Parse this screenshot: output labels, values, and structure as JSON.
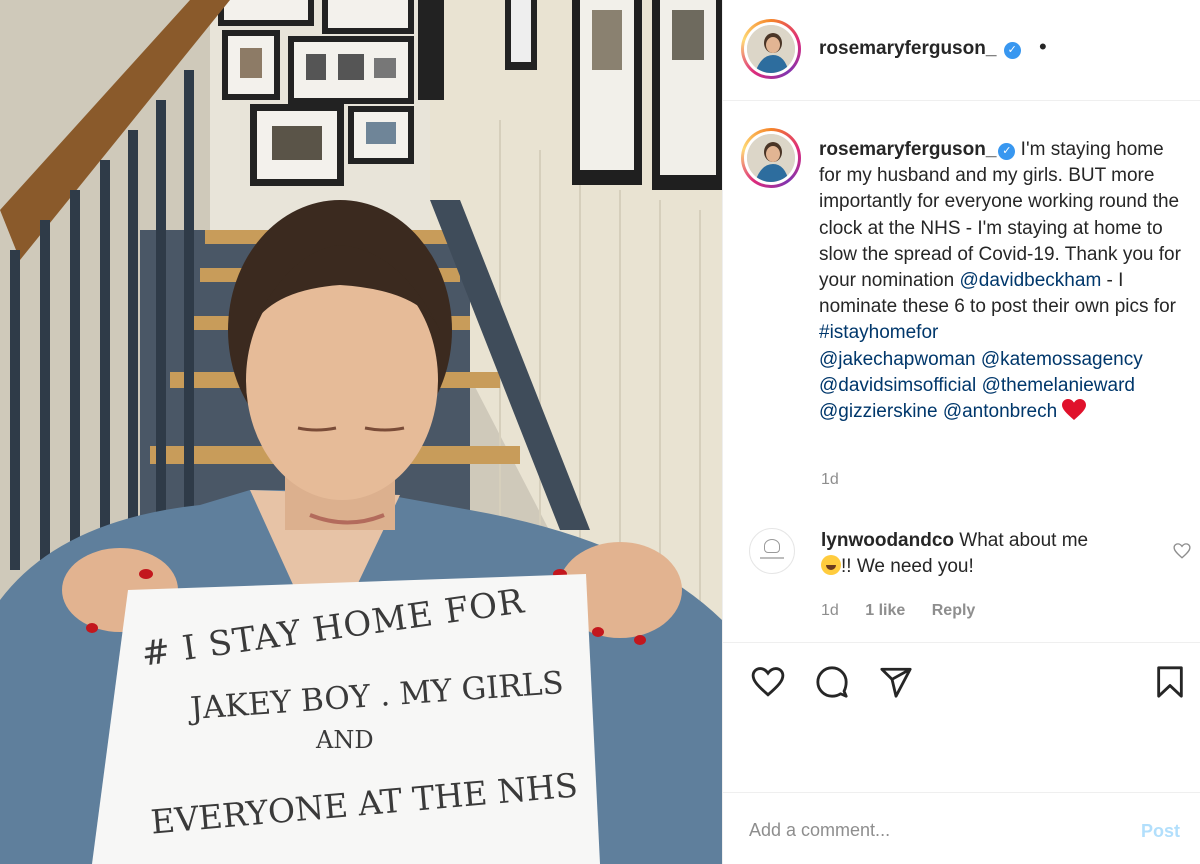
{
  "post": {
    "username": "rosemaryferguson_",
    "verified_mark": "✓",
    "more_dot": "•",
    "caption_parts": {
      "p1": " I'm staying home for my husband and my girls. BUT more importantly for everyone working round the clock at the NHS - I'm staying at home to slow the spread of Covid-19. Thank you for your nomination ",
      "m1": "@davidbeckham",
      "p2": " - I nominate these 6 to post their own pics for ",
      "h1": "#istayhomefor",
      "m2": "@jakechapwoman",
      "m3": "@katemossagency",
      "m4": "@davidsimsofficial",
      "m5": "@themelanieward",
      "m6": "@gizzierskine",
      "m7": "@antonbrech"
    },
    "age": "1d"
  },
  "comment": {
    "username": "lynwoodandco",
    "text_a": " What about me",
    "text_b": "!! We need you!",
    "time": "1d",
    "likes": "1 like",
    "reply": "Reply"
  },
  "add_comment": {
    "placeholder": "Add a comment...",
    "post_label": "Post"
  },
  "photo": {
    "sign_lines": [
      "# I STAY HOME FOR",
      "JAKEY BOY . MY GIRLS",
      "AND",
      "EVERYONE AT THE NHS"
    ]
  },
  "colors": {
    "link": "#00376b",
    "verified": "#3897f0",
    "muted": "#8e8e8e",
    "post_disabled": "#b2dffc",
    "heart": "#e0112b"
  },
  "icons": [
    "heart-icon",
    "comment-icon",
    "share-icon",
    "bookmark-icon",
    "verified-icon",
    "like-comment-icon"
  ]
}
